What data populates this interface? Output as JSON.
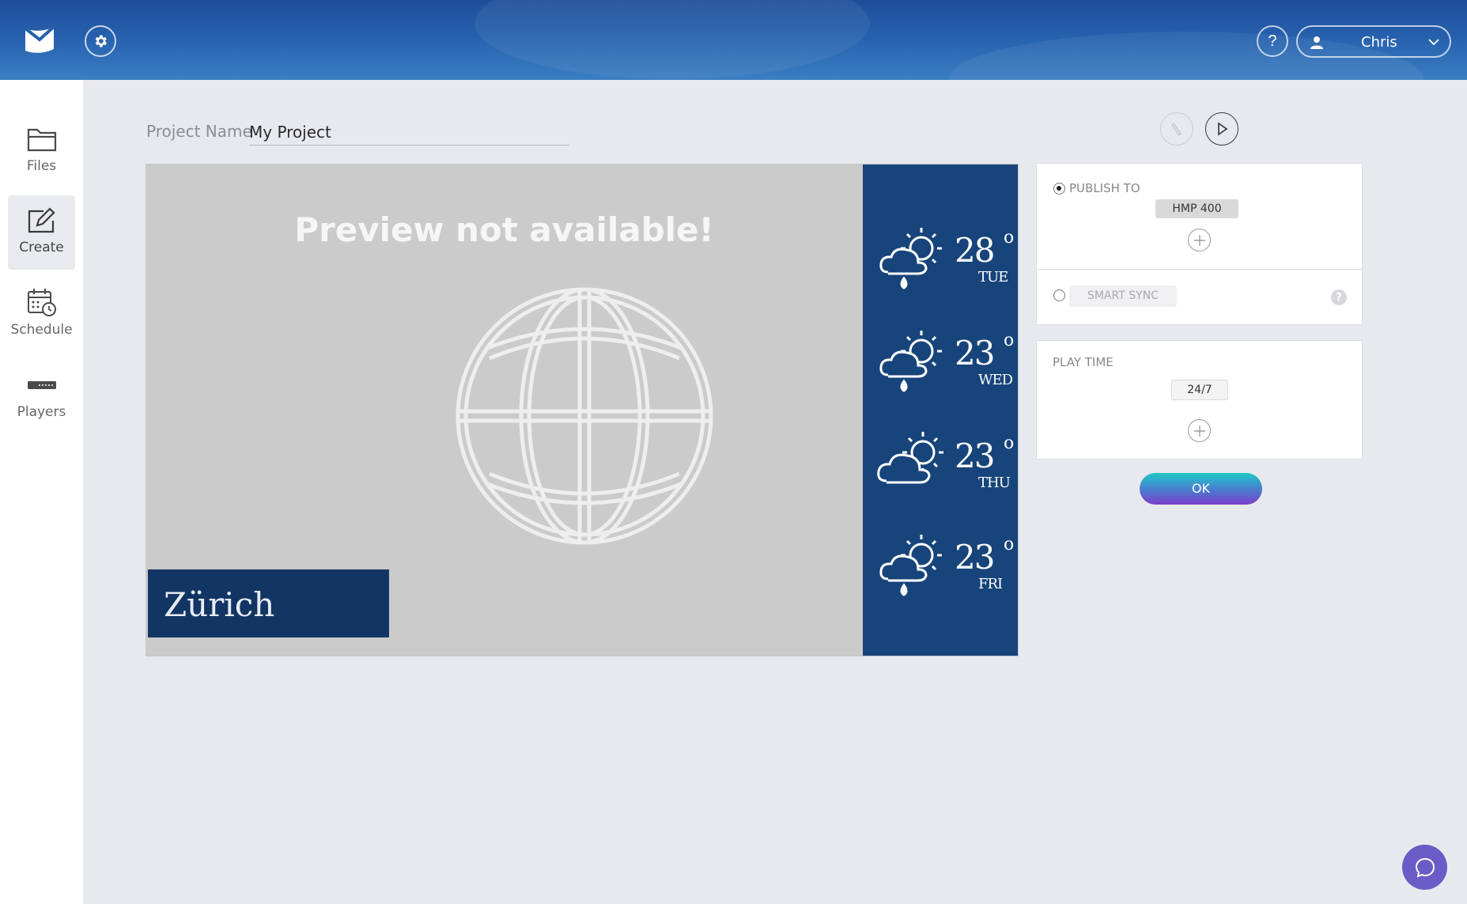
{
  "header": {
    "user_name": "Chris",
    "help_label": "?"
  },
  "sidebar": {
    "items": [
      {
        "label": "Files",
        "icon": "folder-icon"
      },
      {
        "label": "Create",
        "icon": "edit-icon",
        "active": true
      },
      {
        "label": "Schedule",
        "icon": "calendar-clock-icon"
      },
      {
        "label": "Players",
        "icon": "player-device-icon"
      }
    ]
  },
  "project": {
    "label": "Project Name",
    "value": "My Project"
  },
  "preview": {
    "message": "Preview not available!",
    "city": "Zürich",
    "forecast": [
      {
        "temp": "28",
        "day": "TUE",
        "icon": "sun-cloud-rain-icon"
      },
      {
        "temp": "23",
        "day": "WED",
        "icon": "sun-cloud-rain-icon"
      },
      {
        "temp": "23",
        "day": "THU",
        "icon": "sun-cloud-icon"
      },
      {
        "temp": "23",
        "day": "FRI",
        "icon": "sun-cloud-rain-icon"
      }
    ],
    "degree_symbol": "o"
  },
  "publish": {
    "publish_to_label": "PUBLISH TO",
    "publish_to_selected": true,
    "target_chip": "HMP 400",
    "smart_sync_label": "SMART SYNC",
    "smart_sync_selected": false,
    "help_label": "?"
  },
  "play_time": {
    "label": "PLAY TIME",
    "value": "24/7"
  },
  "ok_label": "OK",
  "colors": {
    "header": "#2660ad",
    "preview_bg": "#cbcbcb",
    "weather_panel": "#17447a",
    "city_box": "#123564",
    "chat_button": "#6b5bc7"
  }
}
